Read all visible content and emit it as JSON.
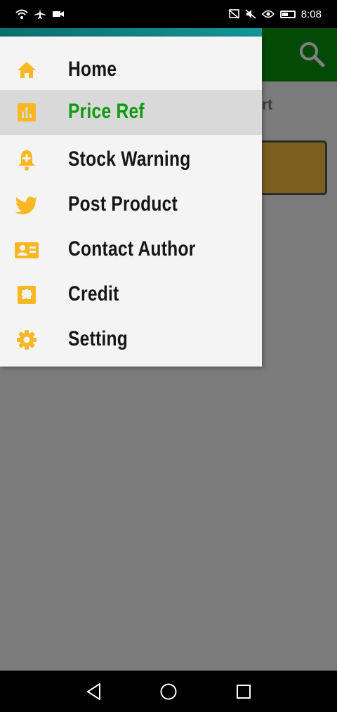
{
  "status_bar": {
    "time": "8:08",
    "icons_left": [
      "wifi-icon",
      "airplane-icon",
      "video-icon"
    ],
    "icons_right": [
      "cast-icon",
      "mute-icon",
      "eye-icon",
      "battery-icon"
    ]
  },
  "background": {
    "label_partial": "rt"
  },
  "drawer": {
    "items": [
      {
        "label": "Home",
        "icon": "home-icon",
        "active": false
      },
      {
        "label": "Price Ref",
        "icon": "bar-chart-icon",
        "active": true
      },
      {
        "label": "Stock Warning",
        "icon": "bell-plus-icon",
        "active": false
      },
      {
        "label": "Post Product",
        "icon": "twitter-icon",
        "active": false
      },
      {
        "label": "Contact Author",
        "icon": "contact-card-icon",
        "active": false
      },
      {
        "label": "Credit",
        "icon": "puzzle-icon",
        "active": false
      },
      {
        "label": "Setting",
        "icon": "gear-icon",
        "active": false
      }
    ]
  },
  "colors": {
    "icon_accent": "#f7b824",
    "active_text": "#0f9a0f",
    "drawer_bg": "#f4f4f4",
    "active_row_bg": "#d9d9d9"
  },
  "nav_bar": {
    "buttons": [
      "back-icon",
      "home-circle-icon",
      "recents-icon"
    ]
  }
}
